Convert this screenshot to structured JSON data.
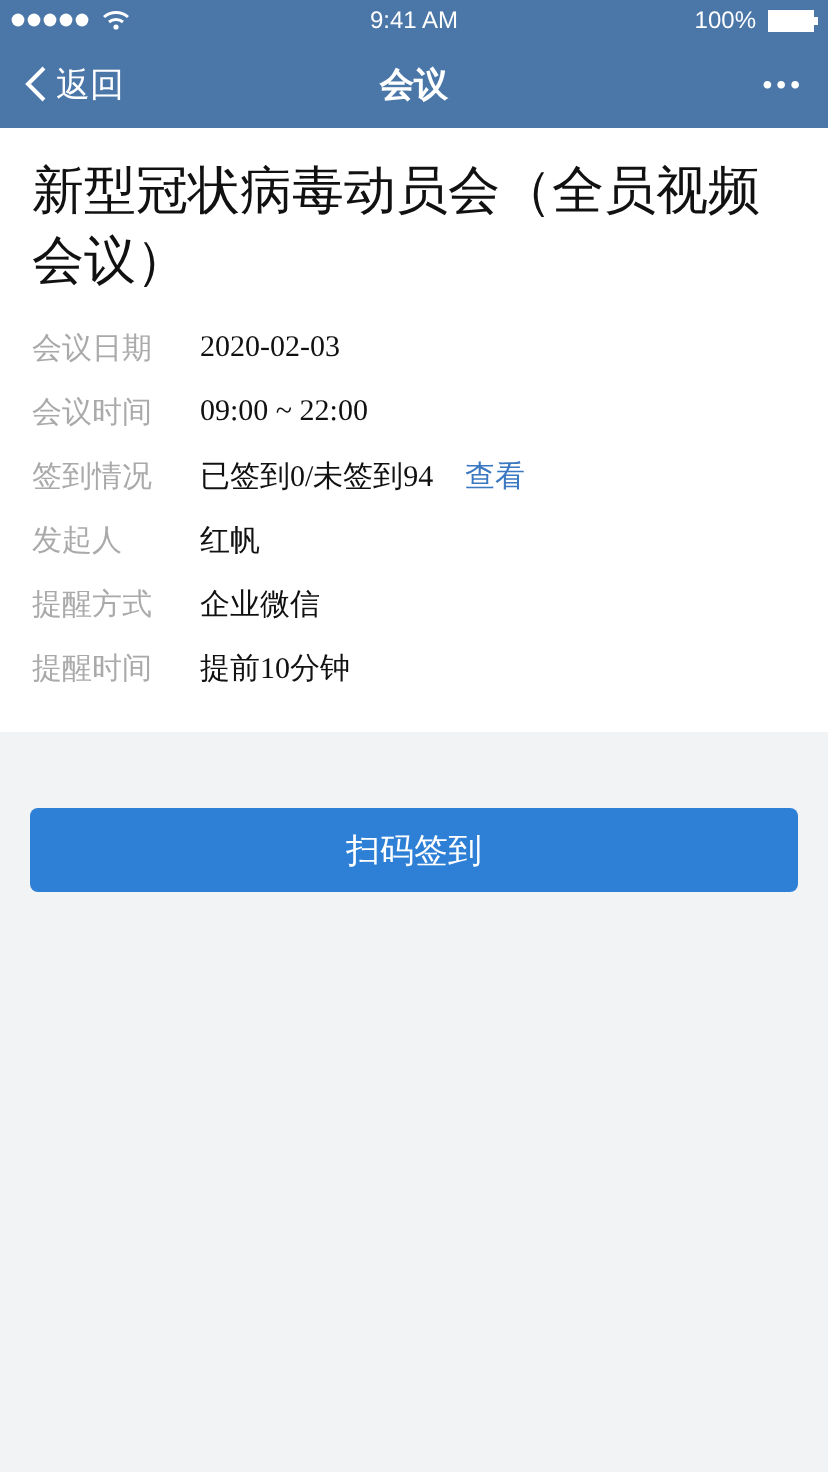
{
  "status_bar": {
    "time": "9:41 AM",
    "battery": "100%"
  },
  "nav": {
    "back": "返回",
    "title": "会议",
    "more": "•••"
  },
  "meeting": {
    "title": "新型冠状病毒动员会（全员视频会议）",
    "fields": [
      {
        "label": "会议日期",
        "value": "2020-02-03"
      },
      {
        "label": "会议时间",
        "value": "09:00 ~ 22:00"
      },
      {
        "label": "签到情况",
        "value": "已签到0/未签到94",
        "link": "查看"
      },
      {
        "label": "发起人",
        "value": "红帆"
      },
      {
        "label": "提醒方式",
        "value": "企业微信"
      },
      {
        "label": "提醒时间",
        "value": "提前10分钟"
      }
    ]
  },
  "action_button": "扫码签到"
}
